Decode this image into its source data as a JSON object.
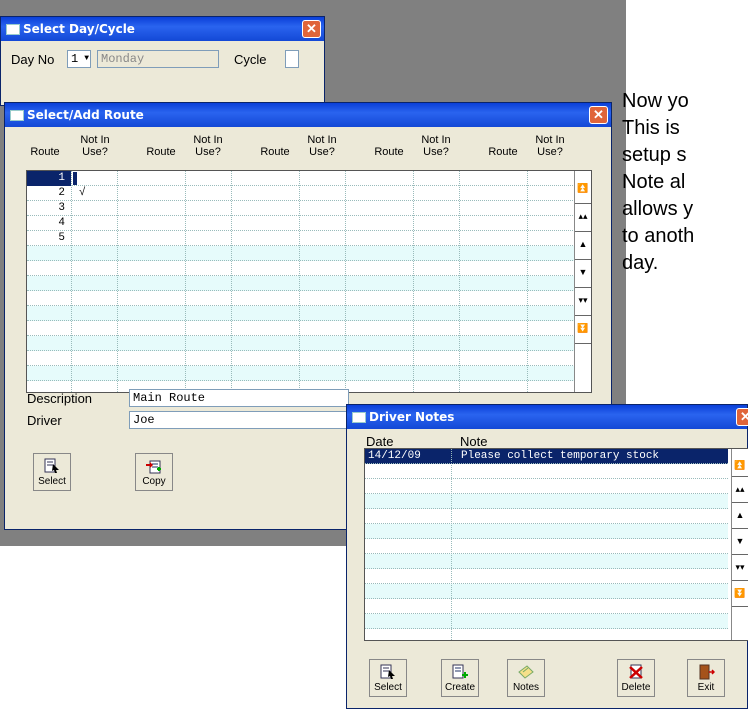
{
  "side_text": [
    "Now yo",
    "This is",
    "setup s",
    "Note al",
    "allows y",
    "to anoth",
    "day."
  ],
  "day_cycle": {
    "title": "Select Day/Cycle",
    "close": "✕",
    "day_no_label": "Day No",
    "day_no_value": "1",
    "day_name": "Monday",
    "cycle_label": "Cycle"
  },
  "route_win": {
    "title": "Select/Add Route",
    "close": "✕",
    "headers": [
      {
        "route": "Route",
        "nu1": "Not In",
        "nu2": "Use?"
      },
      {
        "route": "Route",
        "nu1": "Not In",
        "nu2": "Use?"
      },
      {
        "route": "Route",
        "nu1": "Not In",
        "nu2": "Use?"
      },
      {
        "route": "Route",
        "nu1": "Not In",
        "nu2": "Use?"
      },
      {
        "route": "Route",
        "nu1": "Not In",
        "nu2": "Use?"
      }
    ],
    "rows": [
      {
        "route": "1",
        "not_in_use": ""
      },
      {
        "route": "2",
        "not_in_use": "√"
      },
      {
        "route": "3",
        "not_in_use": ""
      },
      {
        "route": "4",
        "not_in_use": ""
      },
      {
        "route": "5",
        "not_in_use": ""
      }
    ],
    "description_label": "Description",
    "description_value": "Main Route",
    "driver_label": "Driver",
    "driver_value": "Joe",
    "select_label": "Select",
    "copy_label": "Copy"
  },
  "notes_win": {
    "title": "Driver Notes",
    "close": "✕",
    "date_header": "Date",
    "note_header": "Note",
    "rows": [
      {
        "date": "14/12/09",
        "note": "Please collect temporary stock"
      }
    ],
    "buttons": [
      "Select",
      "Create",
      "Notes",
      "Delete",
      "Exit"
    ]
  },
  "scroll_glyphs": [
    "⏫",
    "▴▴",
    "▲",
    "▼",
    "▾▾",
    "⏬"
  ],
  "colors": {
    "selected": "#0a246a",
    "alt_row": "#e6fbfb",
    "title_bar": "#1348d6",
    "close": "#e0653a"
  }
}
